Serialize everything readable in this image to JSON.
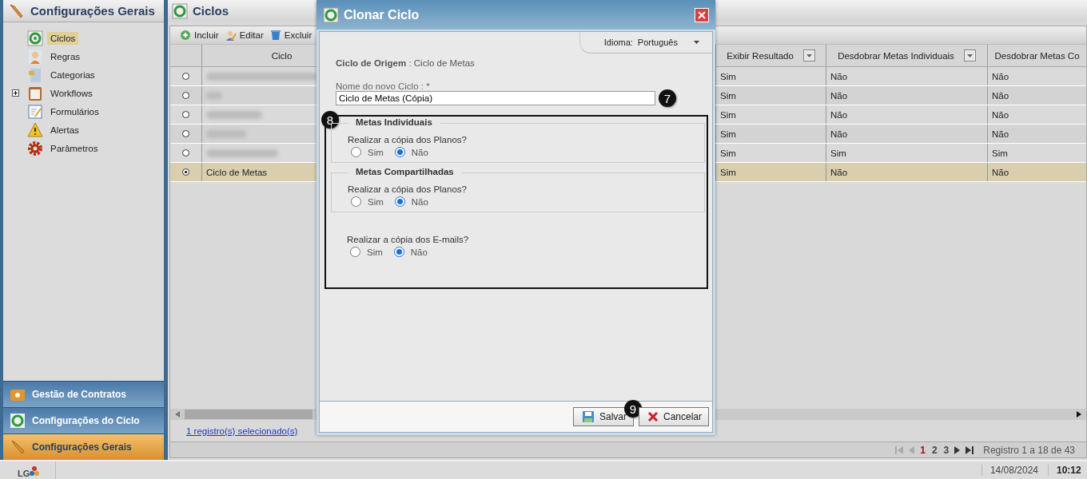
{
  "sidebar": {
    "title": "Configurações Gerais",
    "items": [
      {
        "label": "Ciclos",
        "selected": true
      },
      {
        "label": "Regras",
        "selected": false
      },
      {
        "label": "Categorias",
        "selected": false
      },
      {
        "label": "Workflows",
        "selected": false,
        "expanded": false
      },
      {
        "label": "Formulários",
        "selected": false
      },
      {
        "label": "Alertas",
        "selected": false
      },
      {
        "label": "Parâmetros",
        "selected": false
      }
    ],
    "modules": [
      {
        "label": "Gestão de Contratos",
        "selected": false
      },
      {
        "label": "Configurações do Ciclo",
        "selected": false
      },
      {
        "label": "Configurações Gerais",
        "selected": true
      }
    ]
  },
  "main": {
    "title": "Ciclos",
    "toolbar": [
      "Incluir",
      "Editar",
      "Excluir"
    ],
    "table": {
      "columns": [
        {
          "label": "Ciclo",
          "filter": false
        },
        {
          "label": "Exibir Resultado",
          "filter": true
        },
        {
          "label": "Desdobrar Metas Individuais",
          "filter": true
        },
        {
          "label": "Desdobrar Metas Co",
          "filter": false
        }
      ],
      "rows": [
        {
          "selected": false,
          "redacted": true,
          "cells": [
            "Sim",
            "Não",
            "Não"
          ]
        },
        {
          "selected": false,
          "redacted": true,
          "cells": [
            "Sim",
            "Não",
            "Não"
          ]
        },
        {
          "selected": false,
          "redacted": true,
          "cells": [
            "Sim",
            "Não",
            "Não"
          ]
        },
        {
          "selected": false,
          "redacted": true,
          "cells": [
            "Sim",
            "Não",
            "Não"
          ]
        },
        {
          "selected": false,
          "redacted": true,
          "cells": [
            "Sim",
            "Sim",
            "Sim"
          ]
        },
        {
          "selected": true,
          "ciclo": "Ciclo de Metas",
          "cells": [
            "Sim",
            "Não",
            "Não"
          ]
        }
      ]
    },
    "selection_link": "1 registro(s) selecionado(s)",
    "pager": {
      "pages": [
        {
          "label": "1",
          "selected": true
        },
        {
          "label": "2",
          "selected": false
        },
        {
          "label": "3",
          "selected": false
        }
      ],
      "summary": "Registro 1 a 18 de 43"
    }
  },
  "dialog": {
    "title": "Clonar Ciclo",
    "language_label": "Idioma:",
    "language": "Português",
    "origin": "**Ciclo de Origem** : Ciclo de Metas",
    "name_label": "Nome do novo Ciclo : *",
    "name_value": "Ciclo de Metas (Cópia)",
    "groups": [
      {
        "title": "Metas Individuais",
        "question": "Realizar a cópia dos Planos?",
        "options": [
          {
            "label": "Sim",
            "selected": false
          },
          {
            "label": "Não",
            "selected": true
          }
        ]
      },
      {
        "title": "Metas Compartilhadas",
        "question": "Realizar a cópia dos Planos?",
        "options": [
          {
            "label": "Sim",
            "selected": false
          },
          {
            "label": "Não",
            "selected": true
          }
        ]
      },
      {
        "question": "Realizar a cópia dos E-mails?",
        "options": [
          {
            "label": "Sim",
            "selected": false
          },
          {
            "label": "Não",
            "selected": true
          }
        ]
      }
    ],
    "buttons": [
      {
        "label": "Salvar",
        "kind": "save"
      },
      {
        "label": "Cancelar",
        "kind": "cancel"
      }
    ],
    "markers": [
      "7",
      "8",
      "9"
    ]
  },
  "status_bar": {
    "logo": "LG",
    "date": "14/08/2024",
    "time": "10:12"
  }
}
